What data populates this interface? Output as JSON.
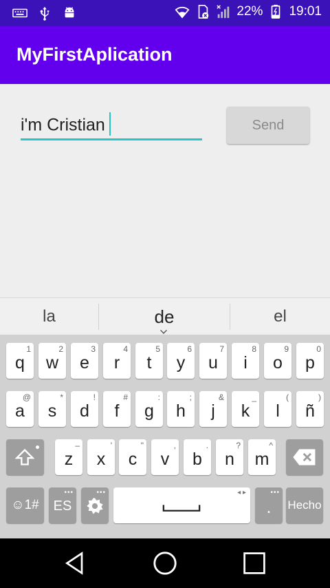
{
  "status_bar": {
    "battery": "22%",
    "time": "19:01",
    "icons": [
      "keyboard-icon",
      "usb-icon",
      "android-icon",
      "wifi-icon",
      "no-sim-icon",
      "signal-icon",
      "battery-icon"
    ]
  },
  "app": {
    "title": "MyFirstAplication",
    "input_value": "i'm Cristian",
    "send_label": "Send"
  },
  "suggestions": [
    "la",
    "de",
    "el"
  ],
  "keyboard": {
    "row1": [
      {
        "k": "q",
        "a": "1"
      },
      {
        "k": "w",
        "a": "2"
      },
      {
        "k": "e",
        "a": "3"
      },
      {
        "k": "r",
        "a": "4"
      },
      {
        "k": "t",
        "a": "5"
      },
      {
        "k": "y",
        "a": "6"
      },
      {
        "k": "u",
        "a": "7"
      },
      {
        "k": "i",
        "a": "8"
      },
      {
        "k": "o",
        "a": "9"
      },
      {
        "k": "p",
        "a": "0"
      }
    ],
    "row2": [
      {
        "k": "a",
        "a": "@"
      },
      {
        "k": "s",
        "a": "*"
      },
      {
        "k": "d",
        "a": "!"
      },
      {
        "k": "f",
        "a": "#"
      },
      {
        "k": "g",
        "a": ":"
      },
      {
        "k": "h",
        "a": ";"
      },
      {
        "k": "j",
        "a": "&"
      },
      {
        "k": "k",
        "a": "_"
      },
      {
        "k": "l",
        "a": "("
      },
      {
        "k": "ñ",
        "a": ")"
      }
    ],
    "row3": [
      {
        "k": "z",
        "a": "–"
      },
      {
        "k": "x",
        "a": "'"
      },
      {
        "k": "c",
        "a": "\""
      },
      {
        "k": "v",
        "a": ","
      },
      {
        "k": "b",
        "a": "."
      },
      {
        "k": "n",
        "a": "?"
      },
      {
        "k": "m",
        "a": "^"
      }
    ],
    "emoji_key": "☺1#",
    "lang_key": "ES",
    "period_key": ".",
    "done_key": "Hecho"
  },
  "colors": {
    "status_bar": "#3a12b8",
    "app_bar": "#6200ee",
    "accent": "#26c6c6"
  }
}
